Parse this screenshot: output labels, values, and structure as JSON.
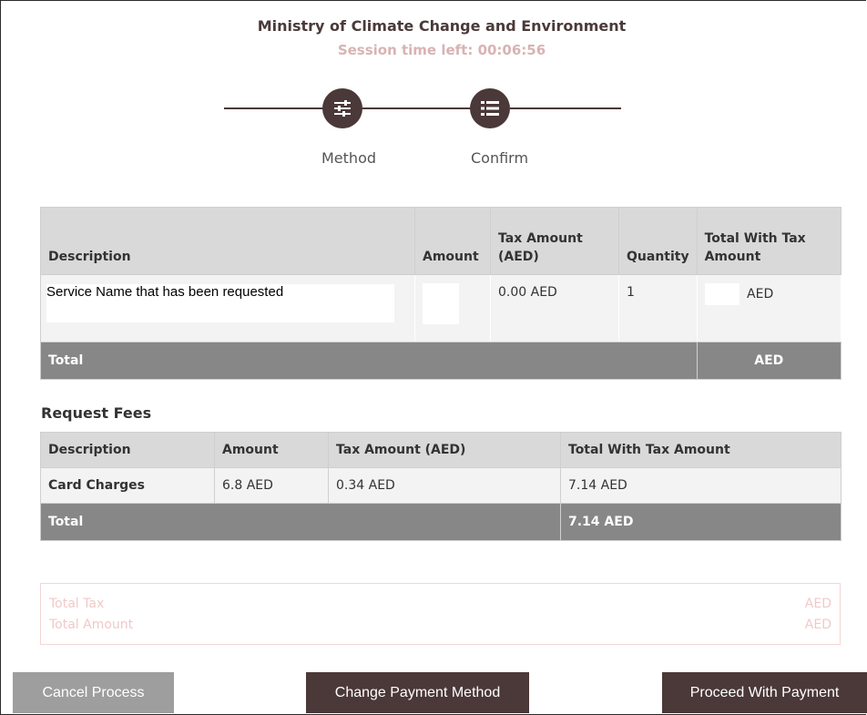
{
  "header": {
    "title": "Ministry of Climate Change and Environment",
    "session": "Session time left: 00:06:56"
  },
  "steps": [
    {
      "label": "Method",
      "icon": "sliders-icon"
    },
    {
      "label": "Confirm",
      "icon": "list-icon"
    }
  ],
  "service_table": {
    "headers": [
      "Description",
      "Amount",
      "Tax Amount (AED)",
      "Quantity",
      "Total With Tax Amount"
    ],
    "row": {
      "description": "Service Name that has been requested",
      "amount": "",
      "tax": "0.00 AED",
      "quantity": "1",
      "total": "AED"
    },
    "footer": {
      "label": "Total",
      "value": "AED"
    }
  },
  "fees": {
    "title": "Request Fees",
    "headers": [
      "Description",
      "Amount",
      "Tax Amount (AED)",
      "Total With Tax Amount"
    ],
    "row": {
      "description": "Card Charges",
      "amount": "6.8 AED",
      "tax": "0.34 AED",
      "total": "7.14 AED"
    },
    "footer": {
      "label": "Total",
      "value": "7.14 AED"
    }
  },
  "summary": {
    "total_tax_label": "Total Tax",
    "total_tax_value": "AED",
    "total_amount_label": "Total Amount",
    "total_amount_value": "AED"
  },
  "buttons": {
    "cancel": "Cancel Process",
    "change": "Change Payment Method",
    "proceed": "Proceed With Payment"
  },
  "colors": {
    "primary": "#4b3838",
    "muted_button": "#9e9e9e",
    "table_footer": "#878787",
    "session_text": "#d8b3b3"
  }
}
